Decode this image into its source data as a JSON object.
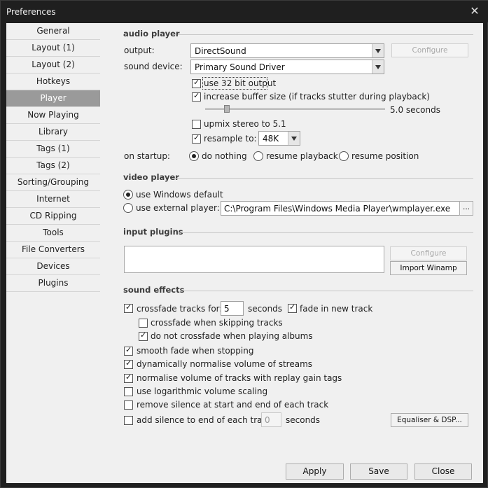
{
  "window": {
    "title": "Preferences",
    "close_glyph": "✕"
  },
  "sidebar": {
    "items": [
      {
        "label": "General"
      },
      {
        "label": "Layout (1)"
      },
      {
        "label": "Layout (2)"
      },
      {
        "label": "Hotkeys"
      },
      {
        "label": "Player",
        "active": true
      },
      {
        "label": "Now Playing"
      },
      {
        "label": "Library"
      },
      {
        "label": "Tags (1)"
      },
      {
        "label": "Tags (2)"
      },
      {
        "label": "Sorting/Grouping"
      },
      {
        "label": "Internet"
      },
      {
        "label": "CD Ripping"
      },
      {
        "label": "Tools"
      },
      {
        "label": "File Converters"
      },
      {
        "label": "Devices"
      },
      {
        "label": "Plugins"
      }
    ]
  },
  "audio": {
    "section_title": "audio player",
    "output_label": "output:",
    "output_value": "DirectSound",
    "configure_label": "Configure",
    "device_label": "sound device:",
    "device_value": "Primary Sound Driver",
    "use32_label": "use 32 bit output",
    "use32_checked": true,
    "buffer_label": "increase buffer size (if tracks stutter during playback)",
    "buffer_checked": true,
    "buffer_value": "5.0 seconds",
    "upmix_label": "upmix stereo to 5.1",
    "upmix_checked": false,
    "resample_label": "resample to:",
    "resample_checked": true,
    "resample_value": "48K",
    "startup_label": "on startup:",
    "startup_options": [
      "do nothing",
      "resume playback",
      "resume position"
    ],
    "startup_selected": 0
  },
  "video": {
    "section_title": "video player",
    "default_label": "use Windows default",
    "external_label": "use external player:",
    "selected": "default",
    "player_path": "C:\\Program Files\\Windows Media Player\\wmplayer.exe",
    "browse_label": "..."
  },
  "plugins": {
    "section_title": "input plugins",
    "configure_label": "Configure",
    "import_label": "Import Winamp"
  },
  "effects": {
    "section_title": "sound effects",
    "crossfade_label": "crossfade tracks for:",
    "crossfade_checked": true,
    "crossfade_seconds": "5",
    "seconds_label": "seconds",
    "fade_in_label": "fade in new track",
    "fade_in_checked": true,
    "skip_label": "crossfade when skipping tracks",
    "skip_checked": false,
    "albums_label": "do not crossfade when playing albums",
    "albums_checked": true,
    "smooth_label": "smooth fade when stopping",
    "smooth_checked": true,
    "normalise_streams_label": "dynamically normalise volume of streams",
    "normalise_streams_checked": true,
    "replay_gain_label": "normalise volume of tracks with replay gain tags",
    "replay_gain_checked": true,
    "log_volume_label": "use logarithmic volume scaling",
    "log_volume_checked": false,
    "remove_silence_label": "remove silence at start and end of each track",
    "remove_silence_checked": false,
    "add_silence_label": "add silence to end of each track:",
    "add_silence_checked": false,
    "add_silence_value": "0",
    "add_seconds_label": "seconds",
    "dsp_label": "Equaliser & DSP..."
  },
  "footer": {
    "apply_label": "Apply",
    "save_label": "Save",
    "close_label": "Close"
  }
}
